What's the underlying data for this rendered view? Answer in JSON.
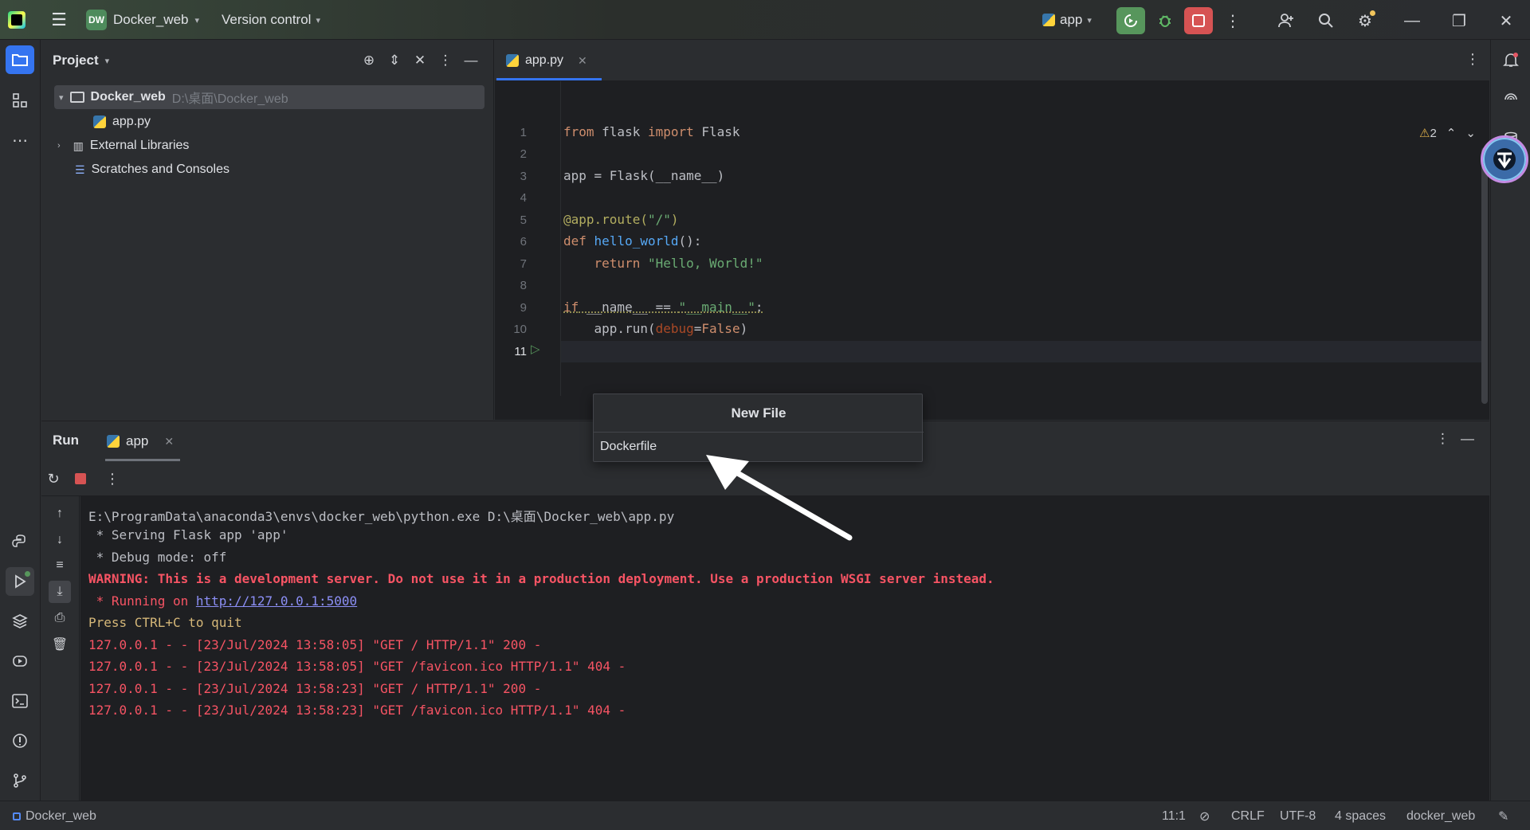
{
  "titlebar": {
    "project_badge": "DW",
    "project_name": "Docker_web",
    "vcs_label": "Version control",
    "run_config": "app"
  },
  "project_panel": {
    "title": "Project",
    "tree": [
      {
        "label": "Docker_web",
        "path": "D:\\桌面\\Docker_web"
      },
      {
        "label": "app.py"
      },
      {
        "label": "External Libraries"
      },
      {
        "label": "Scratches and Consoles"
      }
    ]
  },
  "editor": {
    "tab_label": "app.py",
    "warning_count": "2",
    "line_numbers": [
      "1",
      "2",
      "3",
      "4",
      "5",
      "6",
      "7",
      "8",
      "9",
      "10",
      "11"
    ],
    "lines": [
      "from flask import Flask",
      "",
      "app = Flask(__name__)",
      "",
      "@app.route(\"/\")",
      "def hello_world():",
      "    return \"Hello, World!\"",
      "",
      "if __name__ == \"__main__\":",
      "    app.run(debug=False)",
      ""
    ]
  },
  "new_file_popup": {
    "title": "New File",
    "value": "Dockerfile"
  },
  "run_panel": {
    "title": "Run",
    "tab_label": "app",
    "console": [
      {
        "text": "E:\\ProgramData\\anaconda3\\envs\\docker_web\\python.exe D:\\桌面\\Docker_web\\app.py",
        "style": "normal"
      },
      {
        "text": " * Serving Flask app 'app'",
        "style": "normal"
      },
      {
        "text": " * Debug mode: off",
        "style": "normal"
      },
      {
        "text": "WARNING: This is a development server. Do not use it in a production deployment. Use a production WSGI server instead.",
        "style": "red-bold"
      },
      {
        "prefix": " * Running on ",
        "link": "http://127.0.0.1:5000",
        "style": "red-link"
      },
      {
        "text": "Press CTRL+C to quit",
        "style": "yellow"
      },
      {
        "text": "127.0.0.1 - - [23/Jul/2024 13:58:05] \"GET / HTTP/1.1\" 200 -",
        "style": "red"
      },
      {
        "text": "127.0.0.1 - - [23/Jul/2024 13:58:05] \"GET /favicon.ico HTTP/1.1\" 404 -",
        "style": "red"
      },
      {
        "text": "127.0.0.1 - - [23/Jul/2024 13:58:23] \"GET / HTTP/1.1\" 200 -",
        "style": "red"
      },
      {
        "text": "127.0.0.1 - - [23/Jul/2024 13:58:23] \"GET /favicon.ico HTTP/1.1\" 404 -",
        "style": "red"
      }
    ]
  },
  "statusbar": {
    "project": "Docker_web",
    "position": "11:1",
    "line_sep": "CRLF",
    "encoding": "UTF-8",
    "indent": "4 spaces",
    "interpreter": "docker_web"
  },
  "colors": {
    "accent": "#3574f0",
    "run_green": "#57965c",
    "stop_red": "#d65353",
    "console_red": "#f75464"
  },
  "icons": [
    "pycharm-logo",
    "hamburger-menu-icon",
    "python-icon",
    "rerun-icon",
    "debug-icon",
    "stop-icon",
    "more-icon",
    "add-user-icon",
    "search-icon",
    "settings-icon",
    "minimize-icon",
    "restore-icon",
    "close-icon",
    "folder-icon",
    "structure-icon",
    "python-console-icon",
    "run-icon",
    "layers-icon",
    "services-icon",
    "terminal-icon",
    "problems-icon",
    "git-icon",
    "notifications-icon",
    "ai-assistant-icon",
    "database-icon"
  ]
}
